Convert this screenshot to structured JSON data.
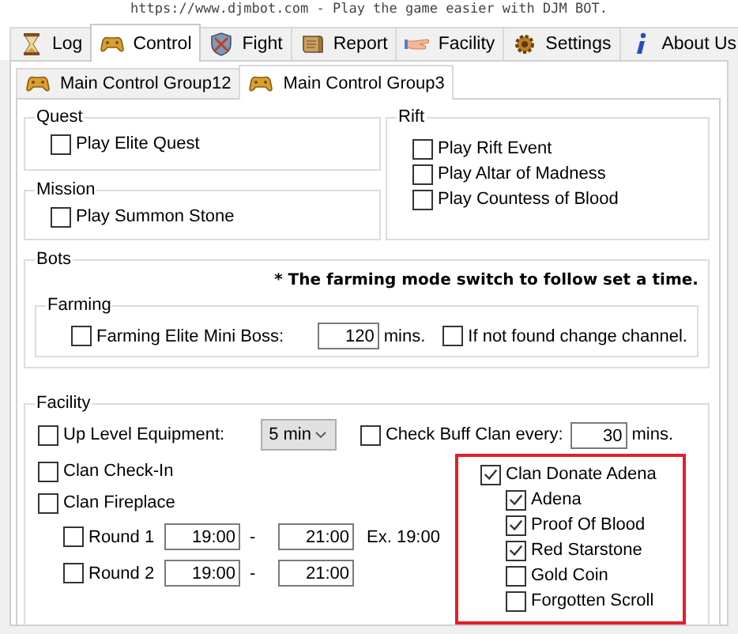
{
  "banner": "https://www.djmbot.com - Play the game easier with DJM BOT.",
  "tabs": [
    {
      "label": "Log",
      "selected": false
    },
    {
      "label": "Control",
      "selected": true
    },
    {
      "label": "Fight",
      "selected": false
    },
    {
      "label": "Report",
      "selected": false
    },
    {
      "label": "Facility",
      "selected": false
    },
    {
      "label": "Settings",
      "selected": false
    },
    {
      "label": "About Us",
      "selected": false
    }
  ],
  "subtabs": [
    {
      "label": "Main Control Group12",
      "selected": false
    },
    {
      "label": "Main Control Group3",
      "selected": true
    }
  ],
  "quest": {
    "title": "Quest",
    "options": [
      {
        "label": "Play Elite Quest",
        "checked": false
      }
    ]
  },
  "mission": {
    "title": "Mission",
    "options": [
      {
        "label": "Play Summon Stone",
        "checked": false
      }
    ]
  },
  "rift": {
    "title": "Rift",
    "options": [
      {
        "label": "Play Rift Event",
        "checked": false
      },
      {
        "label": "Play Altar of Madness",
        "checked": false
      },
      {
        "label": "Play Countess of Blood",
        "checked": false
      }
    ]
  },
  "bots": {
    "title": "Bots",
    "note": "* The farming mode switch to follow set a time.",
    "farming": {
      "title": "Farming",
      "elite": {
        "label": "Farming Elite Mini Boss:",
        "checked": false
      },
      "minutes": "120",
      "unit": "mins.",
      "change_channel": {
        "label": "If not found change channel.",
        "checked": false
      }
    }
  },
  "facility": {
    "title": "Facility",
    "up_level": {
      "label": "Up Level Equipment:",
      "checked": false,
      "interval": "5 min"
    },
    "buff": {
      "label": "Check Buff Clan every:",
      "checked": false,
      "minutes": "30",
      "unit": "mins."
    },
    "options": [
      {
        "label": "Clan Check-In",
        "checked": false
      },
      {
        "label": "Clan Fireplace",
        "checked": false
      }
    ],
    "rounds": [
      {
        "label": "Round 1",
        "checked": false,
        "start": "19:00",
        "dash": "-",
        "end": "21:00",
        "example": "Ex. 19:00"
      },
      {
        "label": "Round 2",
        "checked": false,
        "start": "19:00",
        "dash": "-",
        "end": "21:00"
      }
    ],
    "donate": {
      "label": "Clan Donate Adena",
      "checked": true,
      "items": [
        {
          "label": "Adena",
          "checked": true
        },
        {
          "label": "Proof Of Blood",
          "checked": true
        },
        {
          "label": "Red Starstone",
          "checked": true
        },
        {
          "label": "Gold Coin",
          "checked": false
        },
        {
          "label": "Forgotten Scroll",
          "checked": false
        }
      ]
    }
  }
}
